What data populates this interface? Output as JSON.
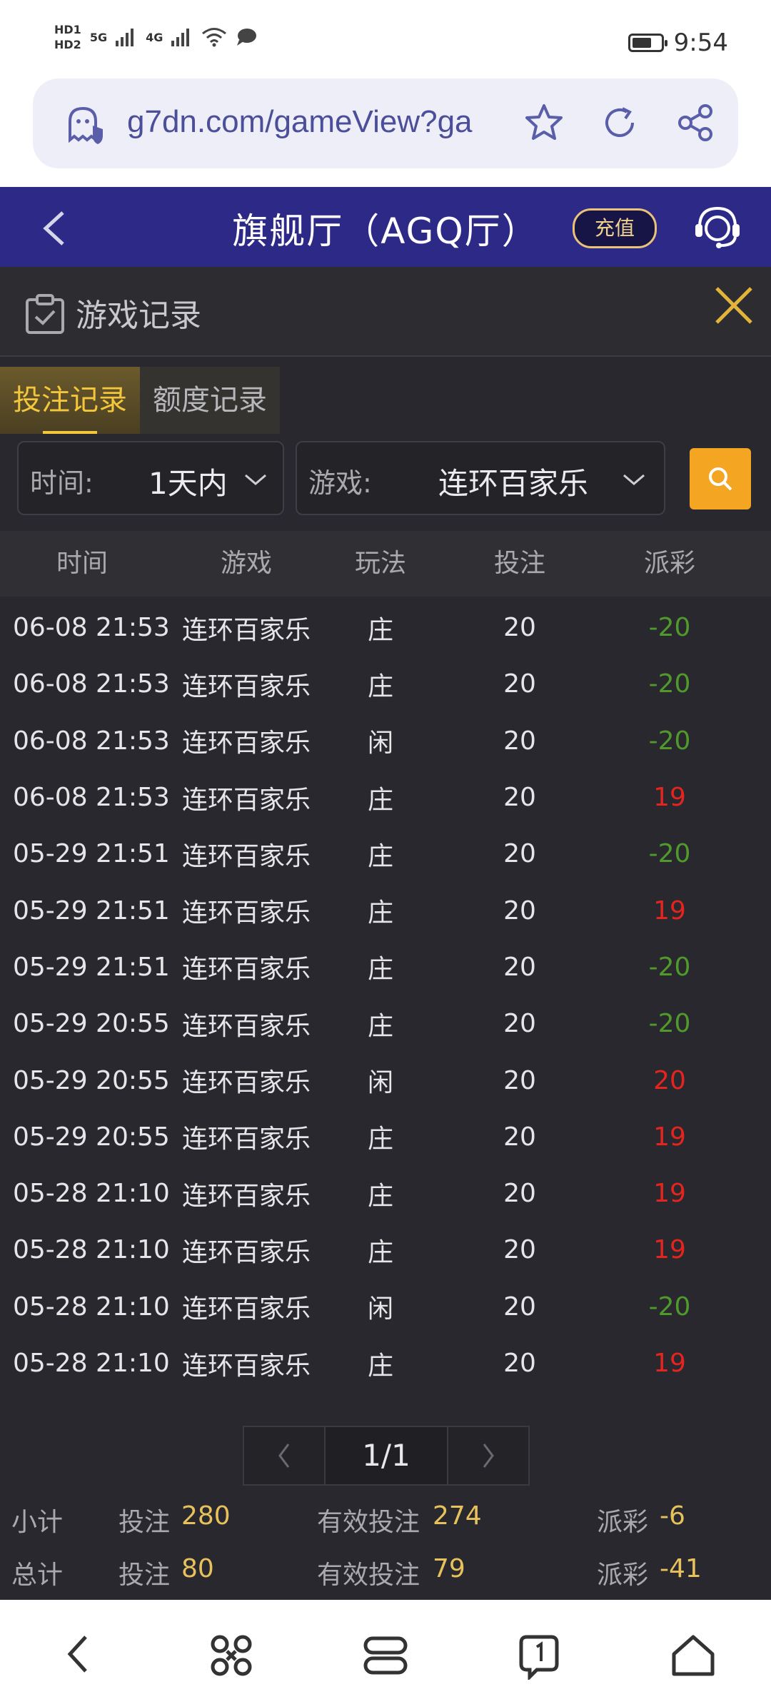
{
  "status_bar": {
    "indicators": [
      "HD1",
      "HD2",
      "5G",
      "4G"
    ],
    "battery_level": 0.7,
    "time": "9:54"
  },
  "browser": {
    "url": "g7dn.com/gameView?ga"
  },
  "header": {
    "title": "旗舰厅（AGQ厅）",
    "recharge_label": "充值"
  },
  "panel": {
    "title": "游戏记录",
    "tabs": [
      {
        "label": "投注记录",
        "active": true
      },
      {
        "label": "额度记录",
        "active": false
      }
    ],
    "filters": {
      "time_label": "时间:",
      "time_value": "1天内",
      "game_label": "游戏:",
      "game_value": "连环百家乐"
    },
    "table": {
      "headers": [
        "时间",
        "游戏",
        "玩法",
        "投注",
        "派彩"
      ],
      "rows": [
        [
          "06-08 21:53",
          "连环百家乐",
          "庄",
          "20",
          "-20"
        ],
        [
          "06-08 21:53",
          "连环百家乐",
          "庄",
          "20",
          "-20"
        ],
        [
          "06-08 21:53",
          "连环百家乐",
          "闲",
          "20",
          "-20"
        ],
        [
          "06-08 21:53",
          "连环百家乐",
          "庄",
          "20",
          "19"
        ],
        [
          "05-29 21:51",
          "连环百家乐",
          "庄",
          "20",
          "-20"
        ],
        [
          "05-29 21:51",
          "连环百家乐",
          "庄",
          "20",
          "19"
        ],
        [
          "05-29 21:51",
          "连环百家乐",
          "庄",
          "20",
          "-20"
        ],
        [
          "05-29 20:55",
          "连环百家乐",
          "庄",
          "20",
          "-20"
        ],
        [
          "05-29 20:55",
          "连环百家乐",
          "闲",
          "20",
          "20"
        ],
        [
          "05-29 20:55",
          "连环百家乐",
          "庄",
          "20",
          "19"
        ],
        [
          "05-28 21:10",
          "连环百家乐",
          "庄",
          "20",
          "19"
        ],
        [
          "05-28 21:10",
          "连环百家乐",
          "庄",
          "20",
          "19"
        ],
        [
          "05-28 21:10",
          "连环百家乐",
          "闲",
          "20",
          "-20"
        ],
        [
          "05-28 21:10",
          "连环百家乐",
          "庄",
          "20",
          "19"
        ]
      ]
    },
    "pagination": {
      "current": "1/1"
    },
    "subtotal": {
      "label": "小计",
      "bet_label": "投注",
      "bet": "280",
      "valid_label": "有效投注",
      "valid": "274",
      "payout_label": "派彩",
      "payout": "-6"
    },
    "total": {
      "label": "总计",
      "bet_label": "投注",
      "bet": "80",
      "valid_label": "有效投注",
      "valid": "79",
      "payout_label": "派彩",
      "payout": "-41"
    }
  },
  "colors": {
    "header_bg": "#2c2a86",
    "accent": "#f4a623",
    "win": "#e3241f",
    "loss": "#4f9a2b"
  }
}
